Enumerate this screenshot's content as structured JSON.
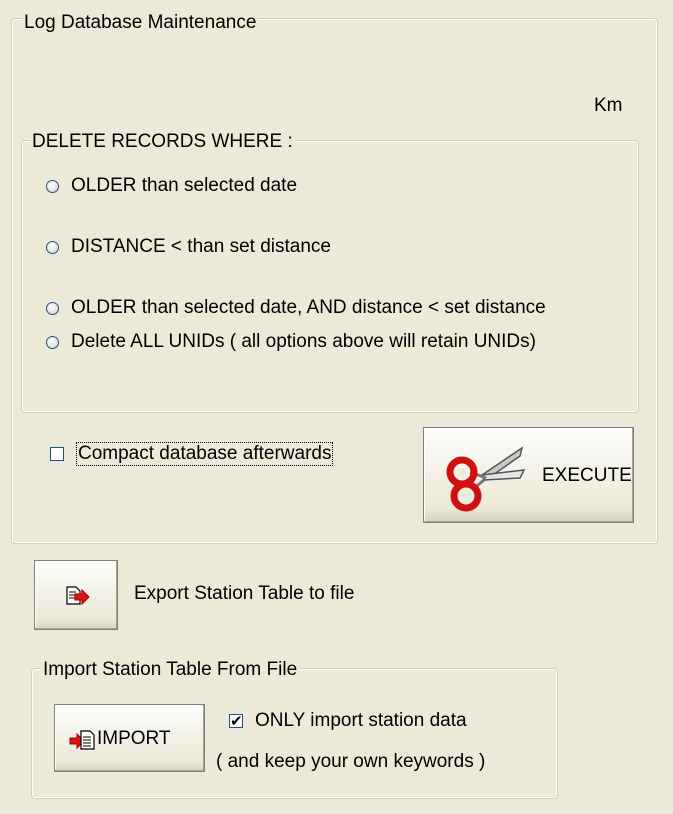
{
  "maintenance": {
    "title": "Log Database Maintenance",
    "unit": "Km",
    "delete": {
      "title": "DELETE RECORDS WHERE :",
      "options": [
        {
          "label": "OLDER than  selected date",
          "selected": false
        },
        {
          "label": "DISTANCE  < than  set distance",
          "selected": false
        },
        {
          "label": "OLDER than  selected date,  AND distance  < set distance",
          "selected": false
        },
        {
          "label": "Delete ALL UNIDs  ( all options above will retain UNIDs)",
          "selected": false
        }
      ]
    },
    "compact": {
      "label": "Compact database afterwards",
      "checked": false
    },
    "execute": {
      "label": "EXECUTE",
      "icon": "scissors-icon"
    }
  },
  "export": {
    "label": "Export Station Table to file",
    "icon": "export-file-icon"
  },
  "import": {
    "title": "Import Station Table From File",
    "button_label": "IMPORT",
    "icon": "import-file-icon",
    "only_station": {
      "label": "ONLY import station data",
      "checked": true
    },
    "note": "( and keep your own keywords )"
  }
}
